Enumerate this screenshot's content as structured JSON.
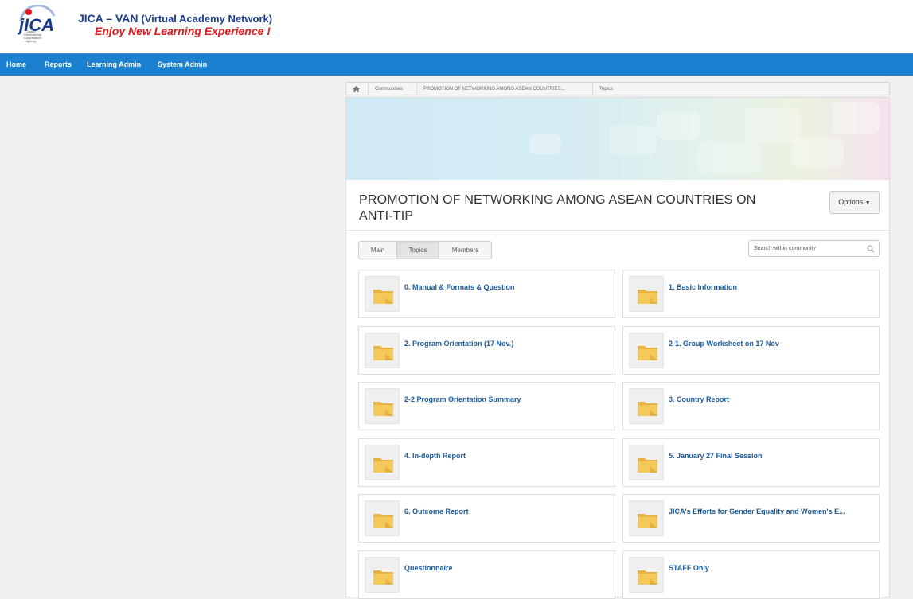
{
  "brand": {
    "logo_text": "jICA",
    "logo_sub": "Japan International Cooperation Agency",
    "title_main": "JICA – VAN",
    "title_rest": "(Virtual Academy Network)",
    "tagline": "Enjoy New Learning Experience !",
    "colors": {
      "navy": "#1a3c8f",
      "red": "#e4171b"
    }
  },
  "nav": {
    "items": [
      "Home",
      "Reports",
      "Learning Admin",
      "System Admin"
    ],
    "color": "#1b80cf"
  },
  "breadcrumb": {
    "home_icon": "home-icon",
    "items": [
      "Communities",
      "PROMOTION OF NETWORKING AMONG ASEAN COUNTRIES...",
      "Topics"
    ]
  },
  "community": {
    "title": "PROMOTION OF NETWORKING AMONG ASEAN COUNTRIES ON ANTI-TIP",
    "options_label": "Options"
  },
  "tabs": {
    "items": [
      "Main",
      "Topics",
      "Members"
    ],
    "active": "Topics"
  },
  "search": {
    "placeholder": "Search within community",
    "icon": "search-icon"
  },
  "topics": [
    "0. Manual & Formats & Question",
    "1. Basic Information",
    "2. Program Orientation (17 Nov.)",
    "2-1. Group Worksheet on 17 Nov",
    "2-2 Program Orientation Summary",
    "3. Country Report",
    "4. In-depth Report",
    "5. January 27 Final Session",
    "6. Outcome Report",
    "JICA's Efforts for Gender Equality and Women's E...",
    "Questionnaire",
    "STAFF Only"
  ],
  "folder_icon": "folder-icon"
}
